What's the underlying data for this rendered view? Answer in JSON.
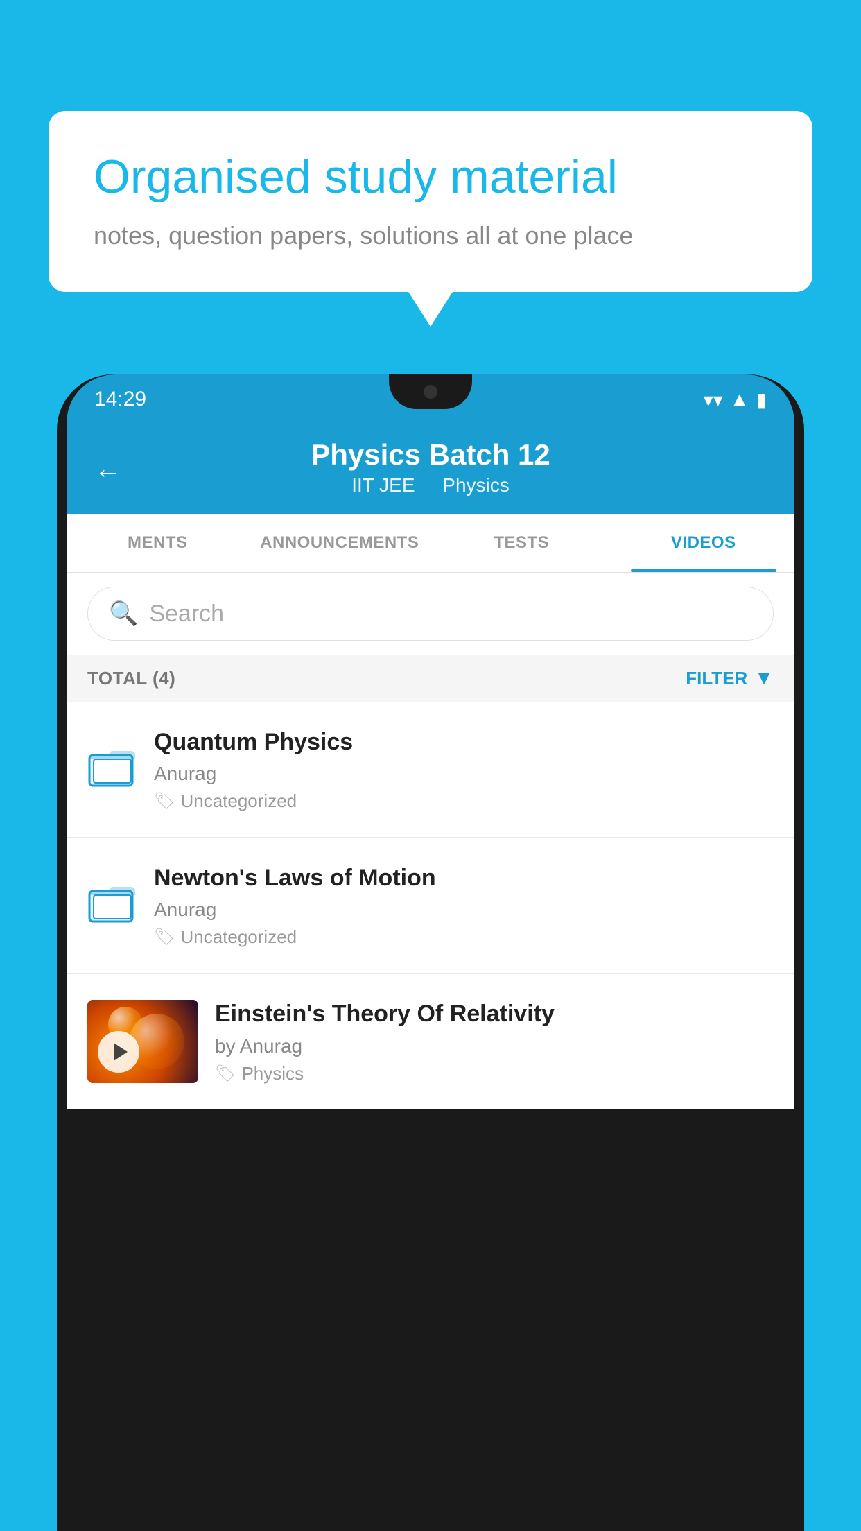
{
  "background_color": "#1ab8e8",
  "speech_bubble": {
    "title": "Organised study material",
    "subtitle": "notes, question papers, solutions all at one place"
  },
  "phone": {
    "status_bar": {
      "time": "14:29",
      "icons": [
        "wifi",
        "signal",
        "battery"
      ]
    },
    "header": {
      "back_label": "←",
      "title": "Physics Batch 12",
      "subtitle_left": "IIT JEE",
      "subtitle_right": "Physics"
    },
    "tabs": [
      {
        "label": "MENTS",
        "active": false
      },
      {
        "label": "ANNOUNCEMENTS",
        "active": false
      },
      {
        "label": "TESTS",
        "active": false
      },
      {
        "label": "VIDEOS",
        "active": true
      }
    ],
    "search": {
      "placeholder": "Search"
    },
    "filter_bar": {
      "total_label": "TOTAL (4)",
      "filter_label": "FILTER"
    },
    "videos": [
      {
        "id": 1,
        "title": "Quantum Physics",
        "author": "Anurag",
        "tag": "Uncategorized",
        "thumb_type": "folder"
      },
      {
        "id": 2,
        "title": "Newton's Laws of Motion",
        "author": "Anurag",
        "tag": "Uncategorized",
        "thumb_type": "folder"
      },
      {
        "id": 3,
        "title": "Einstein's Theory Of Relativity",
        "author": "by Anurag",
        "tag": "Physics",
        "thumb_type": "thumbnail"
      }
    ]
  }
}
